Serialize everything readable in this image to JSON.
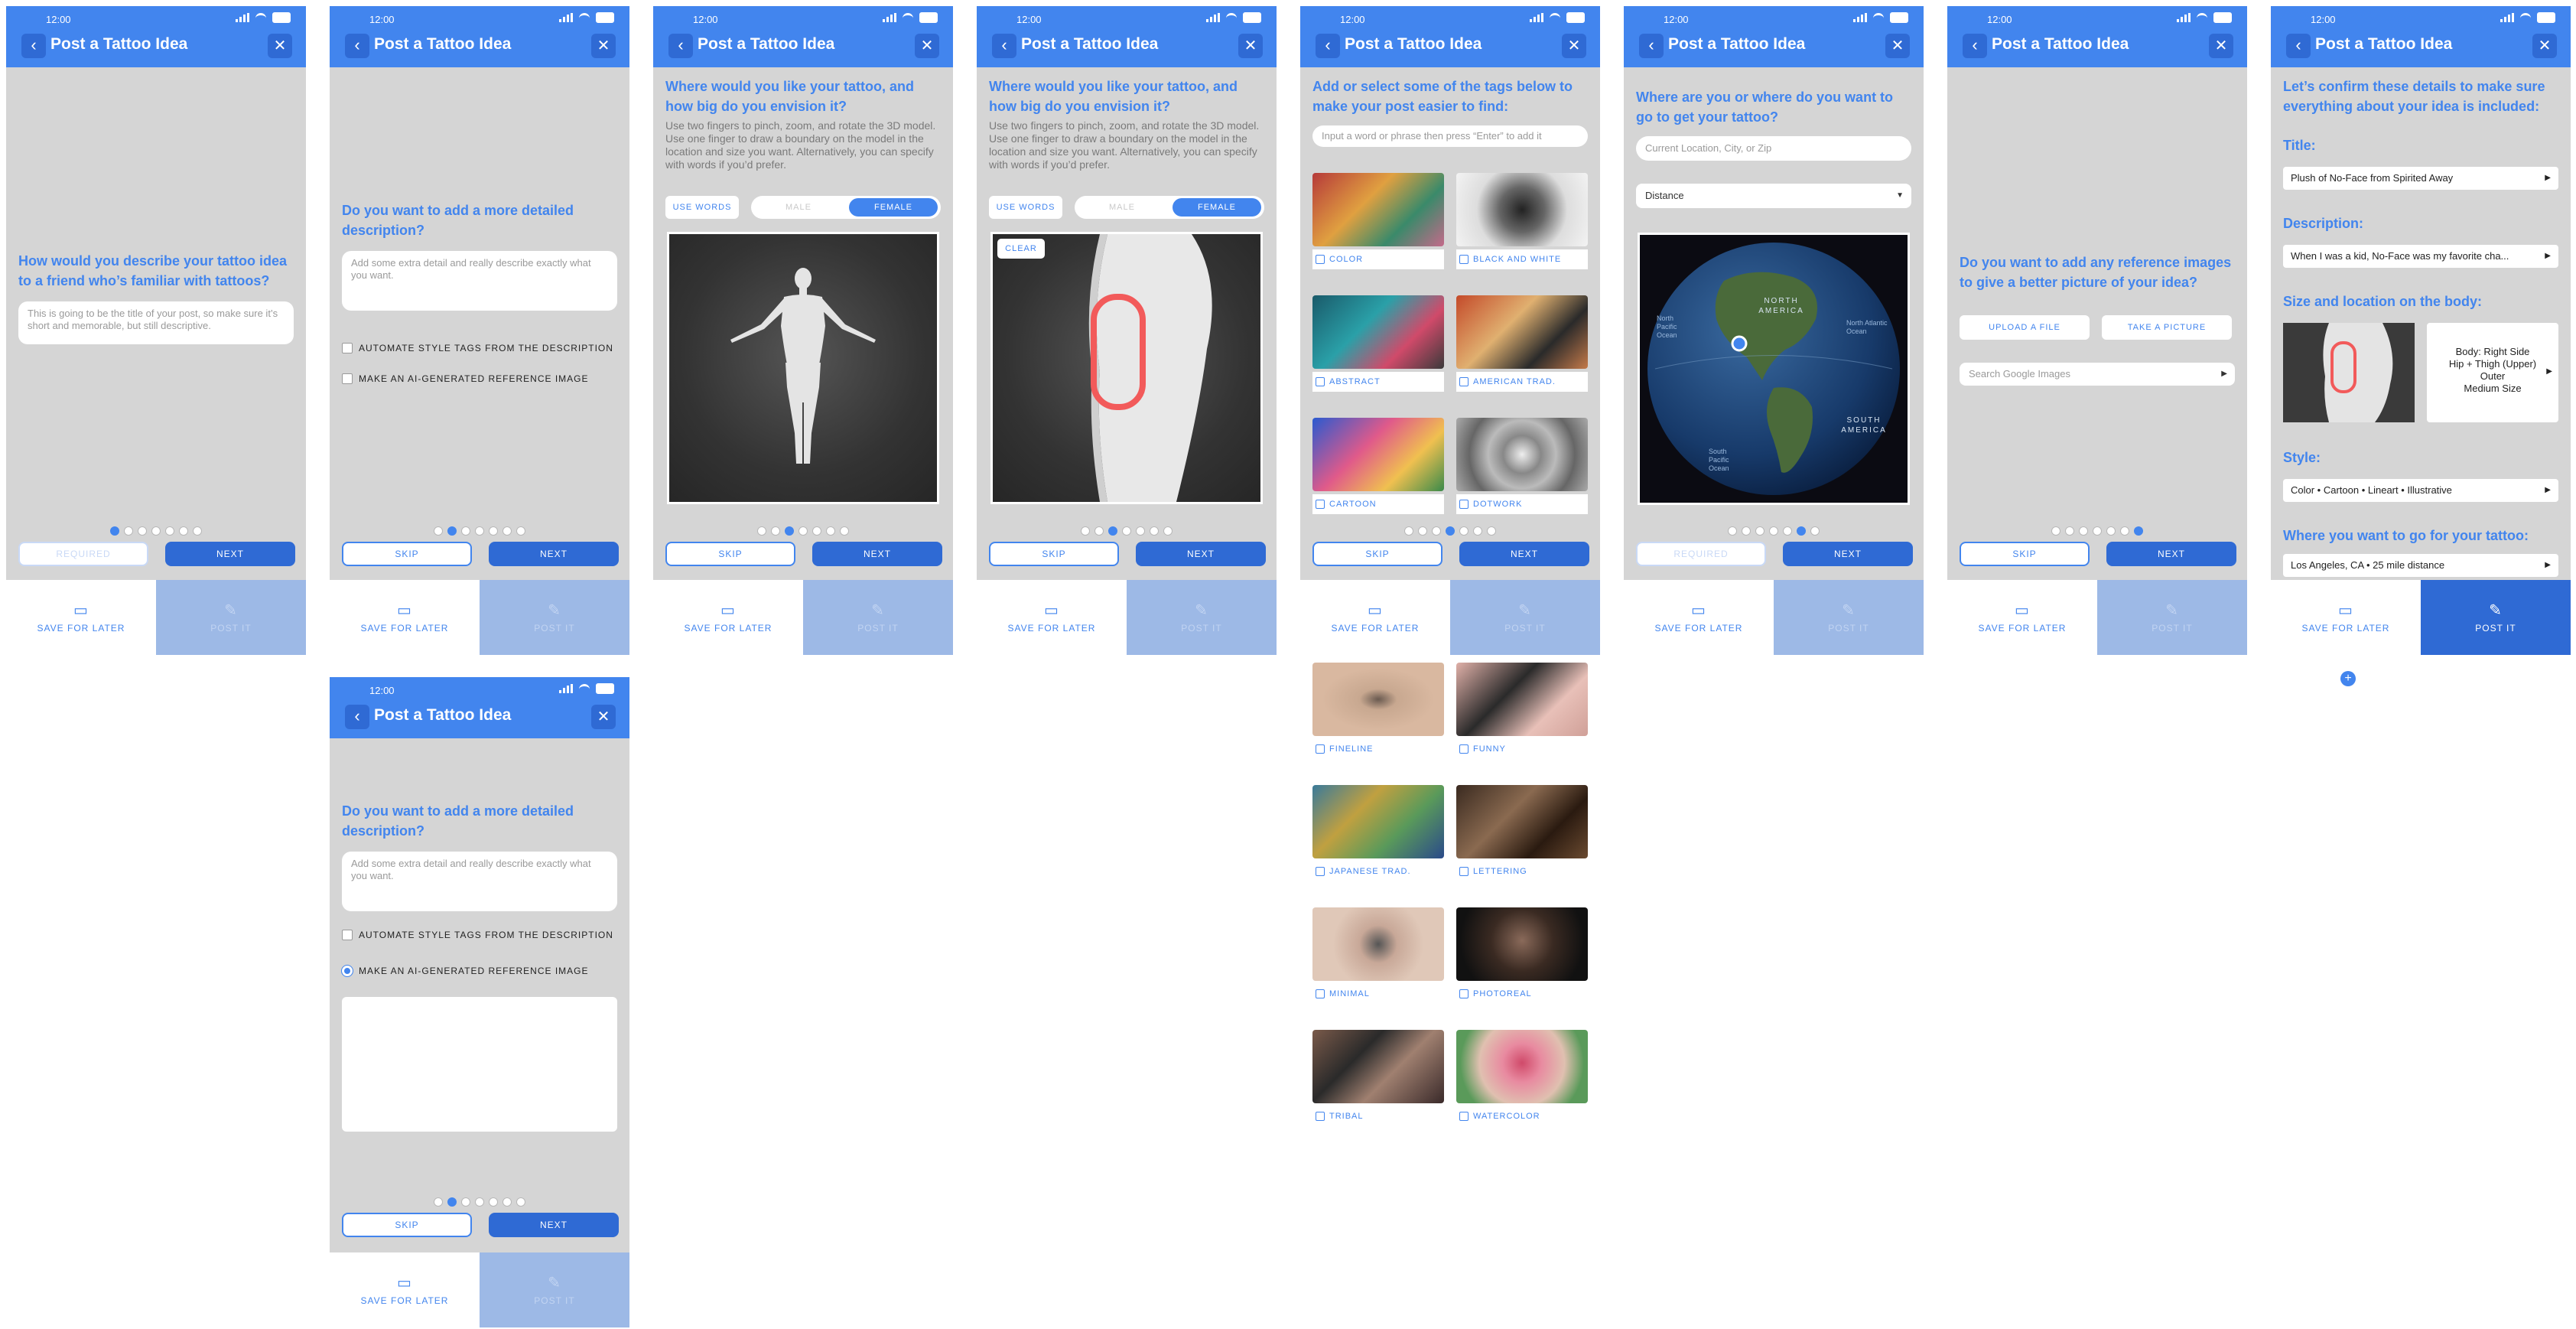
{
  "app": {
    "time": "12:00",
    "title": "Post a Tattoo Idea",
    "back_icon": "chevron-left-icon",
    "close_icon": "close-icon",
    "accent": "#4285ee",
    "accent_dark": "#2f6ad4"
  },
  "buttons": {
    "required": "REQUIRED",
    "skip": "SKIP",
    "next": "NEXT",
    "save_for_later": "SAVE FOR LATER",
    "post_it": "POST IT"
  },
  "screen1": {
    "question": "How would you describe your tattoo idea to a friend who’s familiar with tattoos?",
    "placeholder": "This is going to be the title of your post, so make sure it’s short and memorable, but still descriptive."
  },
  "screen2": {
    "question": "Do you want to add a more detailed description?",
    "placeholder": "Add some extra detail and really describe exactly what you want.",
    "option_auto_tags": "AUTOMATE STYLE TAGS FROM THE DESCRIPTION",
    "option_ai_image": "MAKE AN AI-GENERATED REFERENCE IMAGE"
  },
  "screen3": {
    "question": "Where would you like your tattoo, and how big do you envision it?",
    "instructions": "Use two fingers to pinch, zoom, and rotate the 3D model. Use one finger to draw a boundary on the model in the location and size you want. Alternatively, you can specify with words if you’d prefer.",
    "use_words": "USE WORDS",
    "male": "MALE",
    "female": "FEMALE",
    "clear": "CLEAR"
  },
  "screen5": {
    "question": "Add or select some of the tags below to make your post easier to find:",
    "placeholder": "Input a word or phrase then press “Enter” to add it",
    "tags": [
      "COLOR",
      "BLACK AND WHITE",
      "ABSTRACT",
      "AMERICAN TRAD.",
      "CARTOON",
      "DOTWORK",
      "FINELINE",
      "FUNNY",
      "JAPANESE TRAD.",
      "LETTERING",
      "MINIMAL",
      "PHOTOREAL",
      "TRIBAL",
      "WATERCOLOR"
    ]
  },
  "screen6": {
    "question": "Where are you or where do you want to go to get your tattoo?",
    "location_placeholder": "Current Location, City, or Zip",
    "distance": "Distance",
    "map_labels": {
      "north_america": "NORTH AMERICA",
      "south_america": "SOUTH AMERICA",
      "north_pacific": "North Pacific Ocean",
      "north_atlantic": "North Atlantic Ocean",
      "south_pacific": "South Pacific Ocean"
    }
  },
  "screen7": {
    "question": "Do you want to add any reference images to give a better picture of your idea?",
    "upload": "UPLOAD A FILE",
    "take_picture": "TAKE A PICTURE",
    "search_placeholder": "Search Google Images"
  },
  "screen8": {
    "intro": "Let’s confirm these details to make sure everything about your idea is included:",
    "title_label": "Title:",
    "title_value": "Plush of No-Face from Spirited Away",
    "description_label": "Description:",
    "description_value": "When I was a kid, No-Face was my favorite cha...",
    "size_label": "Size and location on the body:",
    "size_line1": "Body: Right Side",
    "size_line2": "Hip + Thigh (Upper)",
    "size_line3": "Outer",
    "size_line4": "Medium Size",
    "style_label": "Style:",
    "style_value": "Color • Cartoon • Lineart • Illustrative",
    "where_label": "Where you want to go for your tattoo:",
    "where_value": "Los Angeles, CA • 25 mile distance"
  },
  "icons": {
    "save": "folder-icon",
    "post": "pencil-icon",
    "add": "plus-circle-icon"
  },
  "progress": {
    "screen1_step": 1,
    "screen2_step": 2,
    "screen3_step": 3,
    "screen4_step": 3,
    "screen5_step": 4,
    "screen6_step": 6,
    "screen7_step": 7,
    "total_steps": 7
  }
}
